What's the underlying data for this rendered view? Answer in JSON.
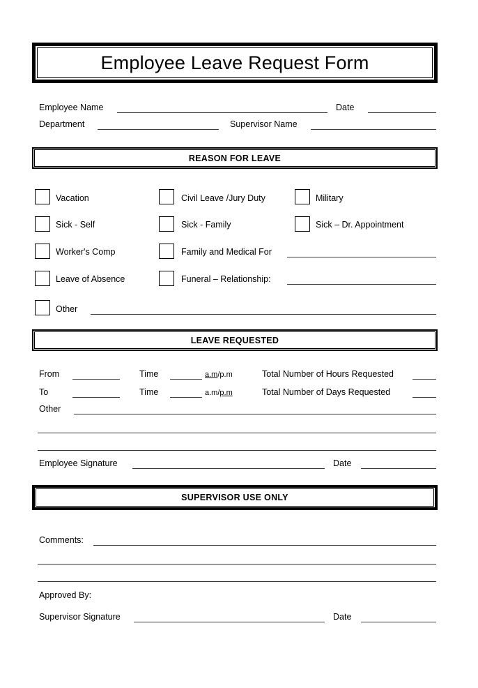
{
  "document": {
    "title": "Employee Leave Request Form"
  },
  "employee_info": {
    "employee_name_label": "Employee Name",
    "employee_name_value": "",
    "date_label": "Date",
    "date_value": "",
    "department_label": "Department",
    "department_value": "",
    "supervisor_name_label": "Supervisor Name",
    "supervisor_name_value": ""
  },
  "reason_for_leave": {
    "header": "REASON FOR LEAVE",
    "options": [
      {
        "label": "Vacation",
        "checked": false,
        "has_line": false
      },
      {
        "label": "Civil Leave /Jury Duty",
        "checked": false,
        "has_line": false
      },
      {
        "label": "Military",
        "checked": false,
        "has_line": false
      },
      {
        "label": "Sick - Self",
        "checked": false,
        "has_line": false
      },
      {
        "label": "Sick - Family",
        "checked": false,
        "has_line": false
      },
      {
        "label": "Sick – Dr. Appointment",
        "checked": false,
        "has_line": false
      },
      {
        "label": "Worker's Comp",
        "checked": false,
        "has_line": false
      },
      {
        "label": "Family and Medical For",
        "checked": false,
        "has_line": true,
        "value": ""
      },
      {
        "label": "Leave of Absence",
        "checked": false,
        "has_line": false
      },
      {
        "label": "Funeral – Relationship:",
        "checked": false,
        "has_line": true,
        "value": ""
      },
      {
        "label": "Other",
        "checked": false,
        "has_line": true,
        "value": ""
      }
    ]
  },
  "leave_requested": {
    "header": "LEAVE REQUESTED",
    "from_label": "From",
    "from_value": "",
    "from_time_label": "Time",
    "from_time_value": "",
    "from_ampm_am": "a.m",
    "from_ampm_sep": "/",
    "from_ampm_pm": "p.m",
    "to_label": "To",
    "to_value": "",
    "to_time_label": "Time",
    "to_time_value": "",
    "to_ampm_am": "a.m",
    "to_ampm_sep": "/",
    "to_ampm_pm": "p.m",
    "total_hours_label": "Total Number of Hours Requested",
    "total_hours_value": "",
    "total_days_label": "Total Number of Days Requested",
    "total_days_value": "",
    "other_label": "Other",
    "other_value": "",
    "other_line_2": "",
    "other_line_3": "",
    "employee_signature_label": "Employee Signature",
    "employee_signature_value": "",
    "employee_date_label": "Date",
    "employee_date_value": ""
  },
  "supervisor_section": {
    "header": "SUPERVISOR USE ONLY",
    "comments_label": "Comments:",
    "comments_value": "",
    "comments_line_2": "",
    "comments_line_3": "",
    "approved_by_label": "Approved By:",
    "supervisor_signature_label": "Supervisor Signature",
    "supervisor_signature_value": "",
    "supervisor_date_label": "Date",
    "supervisor_date_value": ""
  },
  "colors": {
    "ink": "#000000",
    "rule": "#3a3a3a",
    "paper": "#ffffff"
  }
}
